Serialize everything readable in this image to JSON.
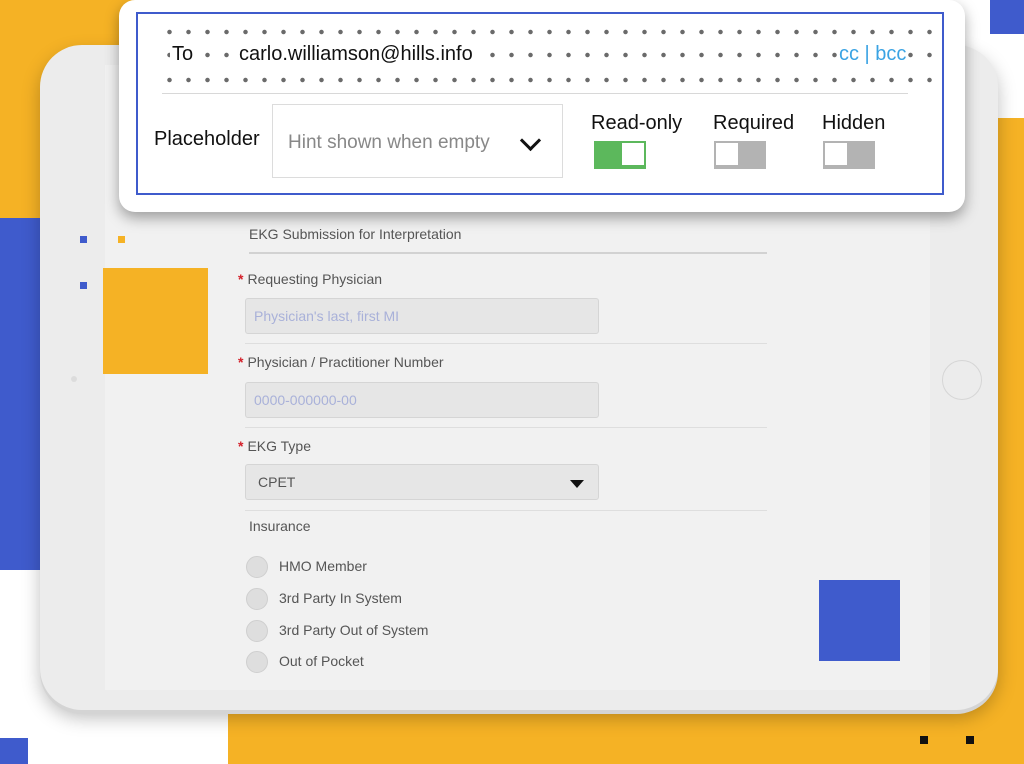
{
  "popup": {
    "to_label": "To",
    "to_value": "carlo.williamson@hills.info",
    "cc_label": "cc | bcc",
    "placeholder_label": "Placeholder",
    "placeholder_value": "Hint shown when empty",
    "toggles": [
      {
        "label": "Read-only",
        "on": true
      },
      {
        "label": "Required",
        "on": false
      },
      {
        "label": "Hidden",
        "on": false
      }
    ]
  },
  "form": {
    "title": "EKG Submission for Interpretation",
    "physician_label": "Requesting Physician",
    "physician_placeholder": "Physician's last, first MI",
    "number_label": "Physician / Practitioner Number",
    "number_placeholder": "0000-000000-00",
    "ekg_type_label": "EKG Type",
    "ekg_type_value": "CPET",
    "insurance_label": "Insurance",
    "insurance_options": [
      "HMO Member",
      "3rd Party In System",
      "3rd Party Out of System",
      "Out of Pocket"
    ],
    "required_mark": "*"
  },
  "colors": {
    "accent_blue": "#3f5bcc",
    "accent_orange": "#f5b225",
    "toggle_on": "#5cb85c",
    "link": "#3aa3e3"
  }
}
